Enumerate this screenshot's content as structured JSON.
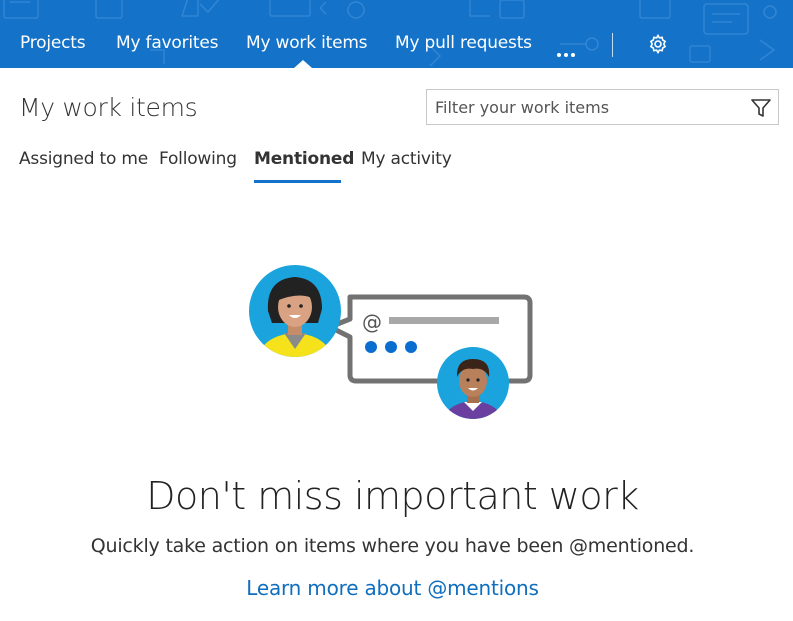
{
  "topnav": {
    "items": [
      {
        "label": "Projects"
      },
      {
        "label": "My favorites"
      },
      {
        "label": "My work items"
      },
      {
        "label": "My pull requests"
      }
    ],
    "active_index": 2,
    "more_icon": "ellipsis-icon",
    "settings_icon": "gear-icon",
    "background_color": "#1473c9"
  },
  "header": {
    "title": "My work items",
    "filter_placeholder": "Filter your work items",
    "filter_icon": "funnel-icon"
  },
  "tabs": [
    {
      "label": "Assigned to me"
    },
    {
      "label": "Following"
    },
    {
      "label": "Mentioned"
    },
    {
      "label": "My activity"
    }
  ],
  "active_tab_index": 2,
  "empty_state": {
    "title": "Don't miss important work",
    "subtitle": "Quickly take action on items where you have been @mentioned.",
    "link": "Learn more about @mentions",
    "bubble_symbol": "@"
  },
  "colors": {
    "accent": "#1473c9",
    "link": "#106ebe",
    "avatar_bg": "#1aa3dc"
  }
}
